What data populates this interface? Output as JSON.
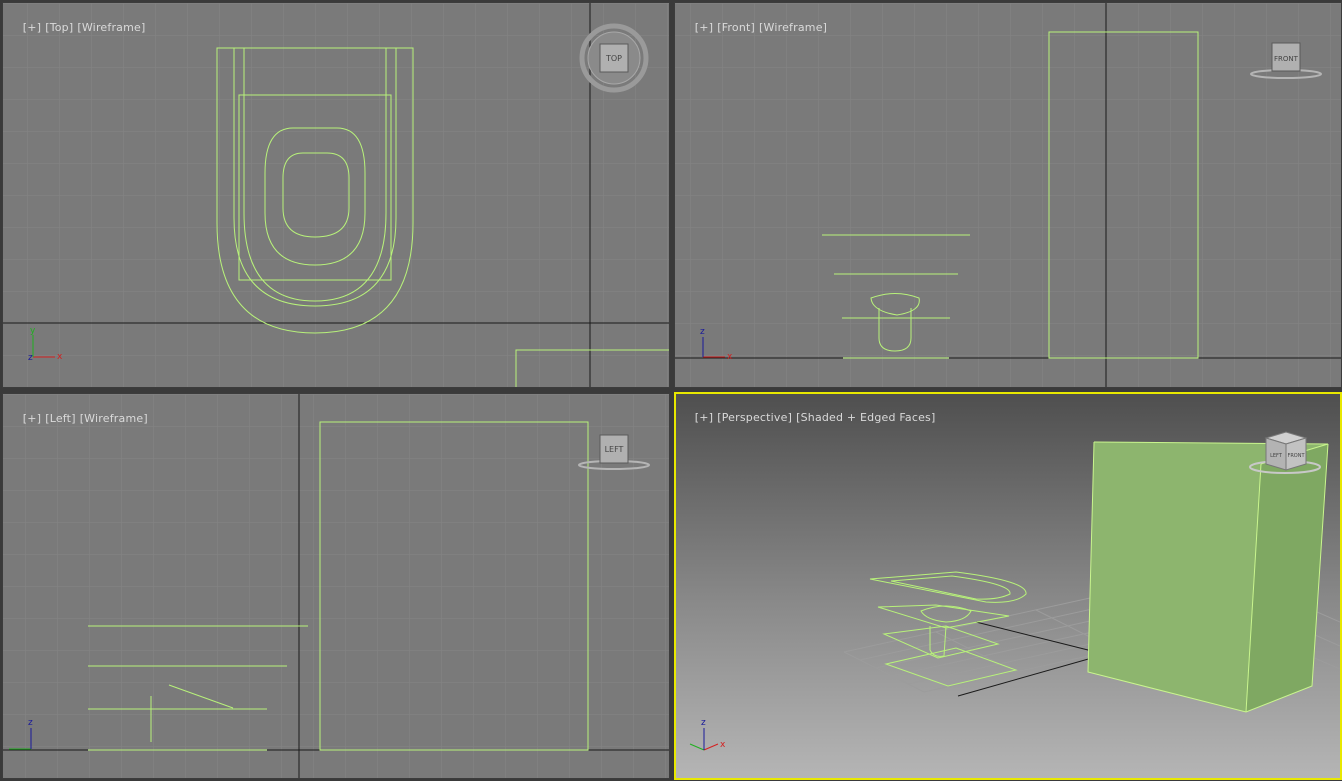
{
  "viewports": {
    "top": {
      "menu": "[+]",
      "view": "[Top]",
      "mode": "[Wireframe]",
      "cube": "TOP"
    },
    "front": {
      "menu": "[+]",
      "view": "[Front]",
      "mode": "[Wireframe]",
      "cube": "FRONT"
    },
    "left": {
      "menu": "[+]",
      "view": "[Left]",
      "mode": "[Wireframe]",
      "cube": "LEFT"
    },
    "persp": {
      "menu": "[+]",
      "view": "[Perspective]",
      "mode": "[Shaded + Edged Faces]",
      "cube_a": "LEFT",
      "cube_b": "FRONT"
    }
  },
  "axes": {
    "x": "x",
    "y": "y",
    "z": "z"
  },
  "colors": {
    "wire": "#b8f27a",
    "active_border": "#e8e800",
    "bg": "#7a7a7a",
    "box_fill": "#8db56e"
  }
}
